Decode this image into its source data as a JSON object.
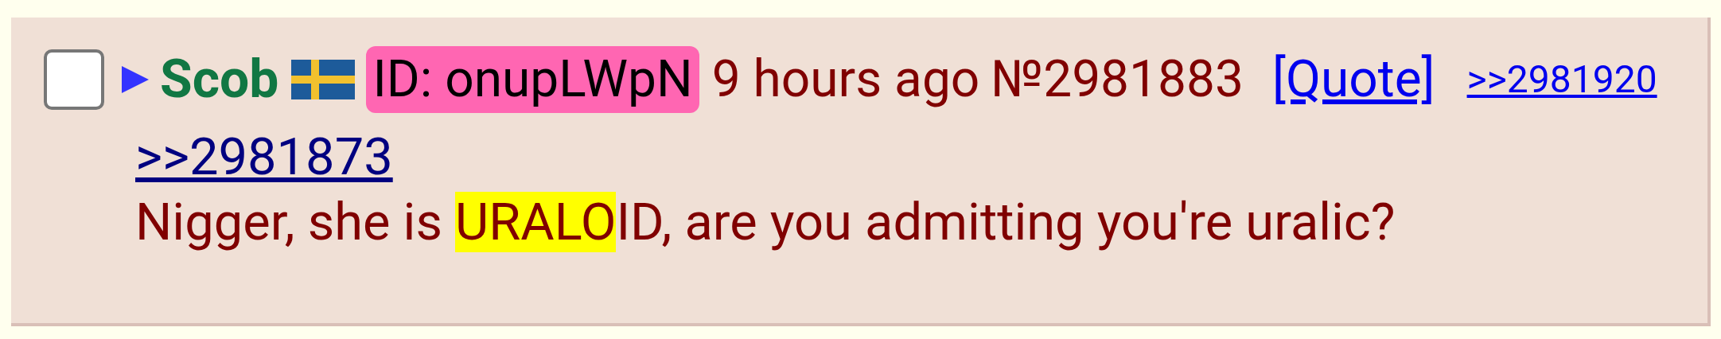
{
  "post": {
    "checked": false,
    "name": "Scob",
    "id_label": "ID: onupLWpN",
    "time": "9 hours ago",
    "number": "№2981883",
    "quote_link": "[Quote]",
    "replies": [
      ">>2981920"
    ],
    "body": {
      "quote": ">>2981873",
      "segments": [
        {
          "text": "Nigger, she is ",
          "highlighted": false
        },
        {
          "text": "URALO",
          "highlighted": true
        },
        {
          "text": "ID, are you admitting you're uralic?",
          "highlighted": false
        }
      ]
    }
  }
}
